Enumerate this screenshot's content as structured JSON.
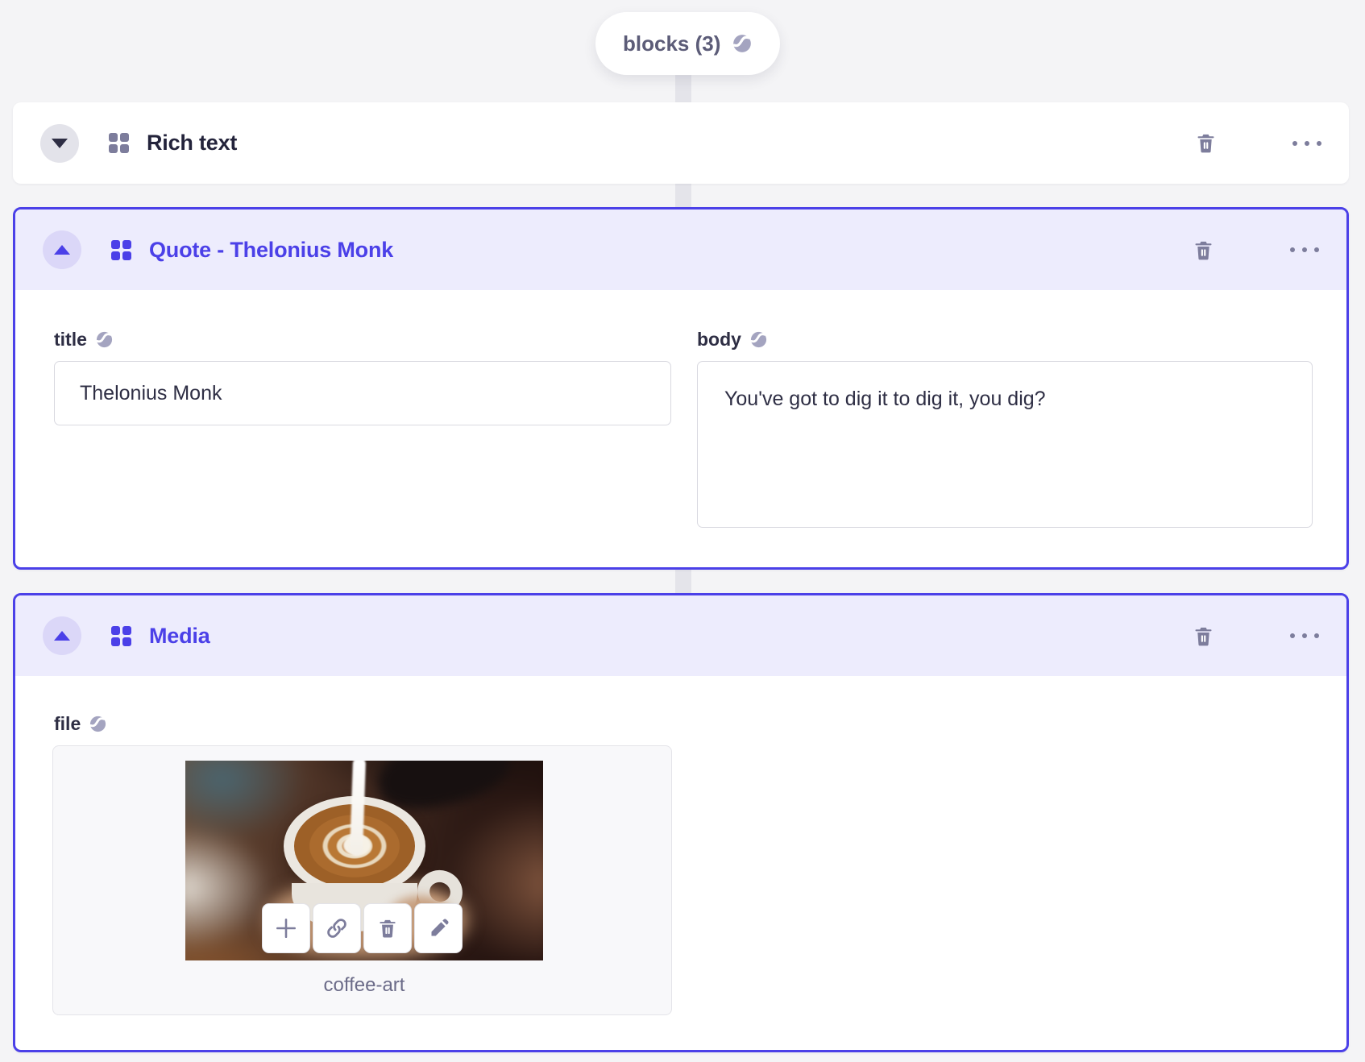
{
  "pill": {
    "label": "blocks (3)"
  },
  "blocks": [
    {
      "title": "Rich text",
      "state": "collapsed",
      "selected": false
    },
    {
      "title": "Quote - Thelonius Monk",
      "state": "expanded",
      "selected": true,
      "fields": {
        "title": {
          "label": "title",
          "value": "Thelonius Monk"
        },
        "body": {
          "label": "body",
          "value": "You've got to dig it to dig it, you dig?"
        }
      }
    },
    {
      "title": "Media",
      "state": "expanded",
      "selected": true,
      "fields": {
        "file": {
          "label": "file",
          "filename": "coffee-art"
        }
      }
    }
  ],
  "icons": {
    "globe": "globe-icon",
    "blocks": "blocks-icon",
    "collapse_down": "chevron-down-icon",
    "collapse_up": "chevron-up-icon",
    "delete": "trash-icon",
    "drag": "drag-handle-icon",
    "menu": "ellipsis-icon",
    "add": "plus-icon",
    "link": "link-icon",
    "edit": "pencil-icon"
  },
  "colors": {
    "accent": "#4b40e8",
    "selected_header_bg": "#edecfd",
    "selected_toggle_bg": "#dbd7f8",
    "icon_gray": "#7d7d9c",
    "page_bg": "#f4f4f6",
    "connector": "#e4e4ea",
    "text_dark": "#23233b",
    "text_label": "#2e2e44",
    "text_muted": "#6b6b88",
    "input_border": "#d9d9e0"
  }
}
